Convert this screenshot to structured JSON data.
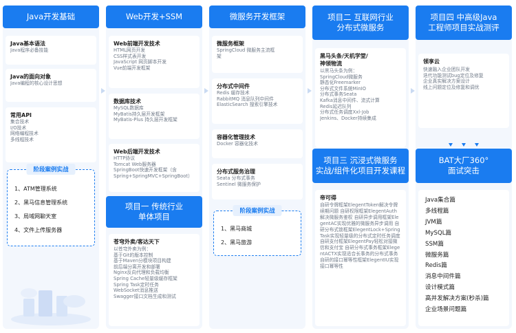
{
  "col1": {
    "header": "Java开发基础",
    "cards": [
      {
        "title": "Java基本语法",
        "lines": [
          "Java程序必备技能"
        ]
      },
      {
        "title": "Java的面向对象",
        "lines": [
          "Java编程的核心设计思想"
        ]
      },
      {
        "title": "常用API",
        "lines": [
          "集合技术",
          "I/O技术",
          "网络编程技术",
          "多线程技术"
        ]
      }
    ],
    "stage": {
      "title": "阶段案例实战",
      "items": [
        "1、ATM管理系统",
        "2、黑马信息管理系统",
        "3、局域网聊天室",
        "4、文件上传服务器"
      ]
    }
  },
  "col2": {
    "header": "Web开发+SSM",
    "cards": [
      {
        "title": "Web前端开发技术",
        "lines": [
          "HTML网页开发",
          "CSS样式表开发",
          "JavaScript 网页脚本开发",
          "Vue前端开发框架"
        ]
      },
      {
        "title": "数据库技术",
        "lines": [
          "MySQL数据库",
          "MyBatis持久层开发框架",
          "MyBatis-Plus 持久层开发框架"
        ]
      },
      {
        "title": "Web后端开发技术",
        "lines": [
          "HTTP协议",
          "Tomcat Web服务器",
          "SpringBoot快速开发框架（含",
          "Spring+SpringMVC+SpringBoot）"
        ]
      }
    ],
    "project_header": "项目一 传统行业\n单体项目",
    "project_card": {
      "title": "苍穹外卖/客达天下",
      "lines": [
        "以苍穹外卖为例：",
        "基于Git的版本控制",
        "基于Maven分模块项目构建",
        "前后端分离开发和部署",
        "Nginx反向代理和负载均衡",
        "Spring Cache轻量级缓存框架",
        "Spring Task定时任务",
        "WebSocket消息推送",
        "Swagger接口文档生成和测试"
      ]
    }
  },
  "col3": {
    "header": "微服务开发框架",
    "cards": [
      {
        "title": "微服务框架",
        "lines": [
          "SpringCloud 微服务主流框",
          "架"
        ]
      },
      {
        "title": "分布式中间件",
        "lines": [
          "Redis 缓存技术",
          "RabbitMQ 消息队列中间件",
          "ElasticSearch 搜索引擎技术"
        ]
      },
      {
        "title": "容器化管理技术",
        "lines": [
          "Docker 容器化技术"
        ]
      },
      {
        "title": "分布式服务治理",
        "lines": [
          "Seata 分布式事务",
          "Sentinel 微服务保护"
        ]
      }
    ],
    "stage": {
      "title": "阶段案例实战",
      "items": [
        "1、黑马商城",
        "2、黑马旅游"
      ]
    }
  },
  "col4": {
    "header": "项目二 互联网行业\n分布式微服务",
    "card": {
      "title": "黑马头条/天机学堂/\n神领物流",
      "lines": [
        "以黑马头条为例：",
        "SpringCloud微服务",
        "静态化Freemarker",
        "分布式文件系统MinIO",
        "分布式事务Seata",
        "Kafka消息中间件、流式计算",
        "Redis延迟队列",
        "分布式任务调度Xxl-Job",
        "Jenkins、Docker持续集成"
      ]
    },
    "header2": "项目三 沉浸式微服务\n实战/组件化项目开发课程",
    "card2": {
      "title": "帝可得",
      "text": "自研令牌框架ElegentToken解决令牌续期问题 自研权限框架ElegentAuth解决微服务鉴权 自研异步调用框架ElegentAC实现优雅的微服务异步调用 自研分布式锁框架ElegentLock+SpringTask实现轻量级的分布式定时任务调度 自研支付框架ElegentPay轻松对接微信和支付宝 自研分布式事务框架ElegentACTX实现适合长事务的分布式事务 自研的接口幂等性框架ElegentIU实现接口幂等性"
    }
  },
  "col5": {
    "header": "项目四 中高级Java\n工程师项目实战测评",
    "card": {
      "title": "领享云",
      "lines": [
        "快速融入企业团队开发",
        "迭代功能测试bug定位及修复",
        "企业真实解决方案设计",
        "线上问题定位及修复和调优"
      ]
    },
    "header2": "BAT大厂360°\n面试突击",
    "items": [
      "Java集合篇",
      "多线程篇",
      "JVM篇",
      "MySQL篇",
      "SSM篇",
      "微服务篇",
      "Redis篇",
      "消息中间件篇",
      "设计模式篇",
      "高并发解决方案(秒杀)篇",
      "企业场景问题篇"
    ]
  },
  "colors": {
    "accent": "#1a7cf0",
    "panel": "#f3f7fd"
  }
}
